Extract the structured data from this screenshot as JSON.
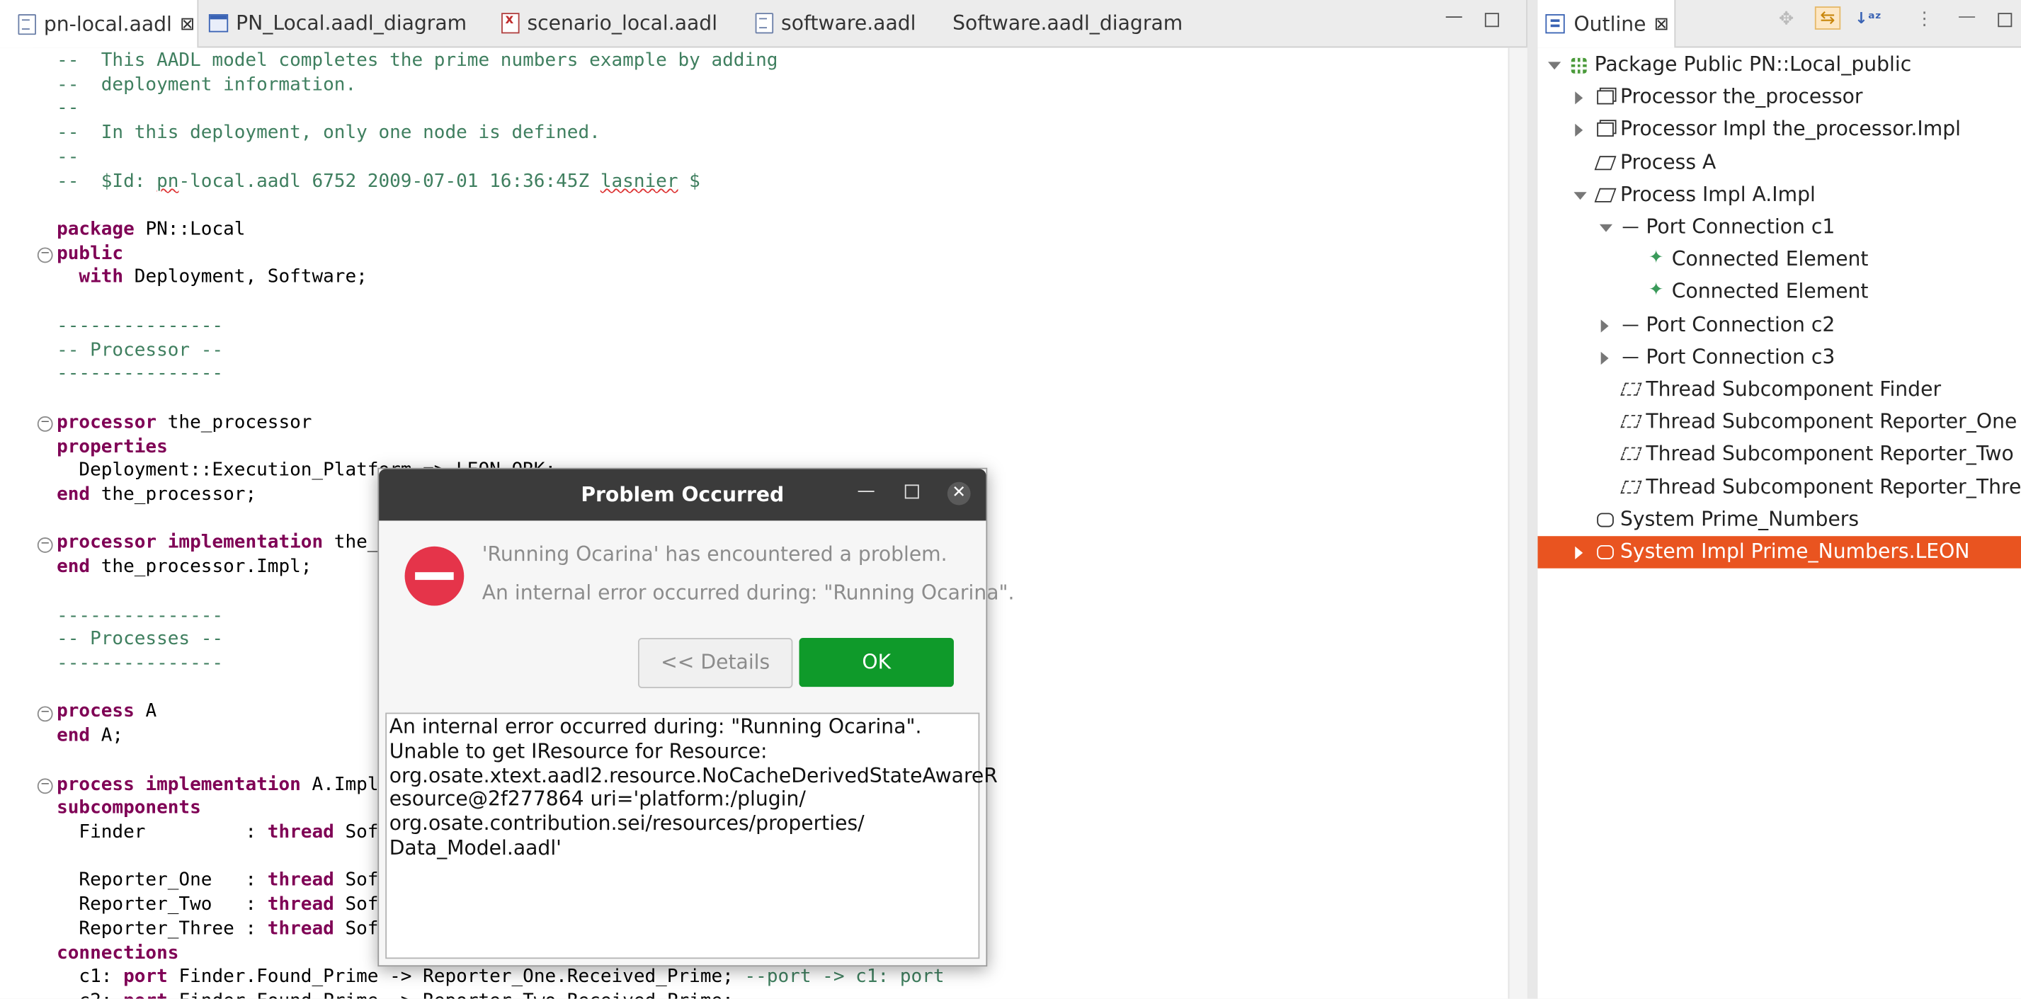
{
  "editor": {
    "tabs": [
      {
        "label": "pn-local.aadl",
        "active": true,
        "icon": "aadl-file-icon",
        "close": "⊠"
      },
      {
        "label": "PN_Local.aadl_diagram",
        "icon": "diagram-icon"
      },
      {
        "label": "scenario_local.aadl",
        "icon": "scenario-file-icon"
      },
      {
        "label": "software.aadl",
        "icon": "aadl-file-icon"
      },
      {
        "label": "Software.aadl_diagram",
        "icon": ""
      }
    ],
    "code": [
      [
        [
          "cm",
          "--  This AADL model completes the prime numbers example by adding"
        ]
      ],
      [
        [
          "cm",
          "--  deployment information."
        ]
      ],
      [
        [
          "cm",
          "--"
        ]
      ],
      [
        [
          "cm",
          "--  In this deployment, only one node is defined."
        ]
      ],
      [
        [
          "cm",
          "--"
        ]
      ],
      [
        [
          "cm",
          "--  $Id: "
        ],
        [
          "cmsq",
          "pn"
        ],
        [
          "cm",
          "-local.aadl 6752 2009-07-01 16:36:45Z "
        ],
        [
          "cmsq",
          "lasnier"
        ],
        [
          "cm",
          " $"
        ]
      ],
      [],
      [
        [
          "kw",
          "package"
        ],
        [
          "t",
          " PN::Local"
        ]
      ],
      [
        [
          "kw",
          "public"
        ]
      ],
      [
        [
          "t",
          "  "
        ],
        [
          "kw",
          "with"
        ],
        [
          "t",
          " Deployment, Software;"
        ]
      ],
      [],
      [
        [
          "cm",
          "---------------"
        ]
      ],
      [
        [
          "cm",
          "-- Processor --"
        ]
      ],
      [
        [
          "cm",
          "---------------"
        ]
      ],
      [],
      [
        [
          "kw",
          "processor"
        ],
        [
          "t",
          " the_processor"
        ]
      ],
      [
        [
          "kw",
          "properties"
        ]
      ],
      [
        [
          "t",
          "  Deployment::Execution_Platform => LEON_ORK;"
        ]
      ],
      [
        [
          "kw",
          "end"
        ],
        [
          "t",
          " the_processor;"
        ]
      ],
      [],
      [
        [
          "kw",
          "processor"
        ],
        [
          "t",
          " "
        ],
        [
          "kw",
          "implementation"
        ],
        [
          "t",
          " the_processor.Impl"
        ]
      ],
      [
        [
          "kw",
          "end"
        ],
        [
          "t",
          " the_processor.Impl;"
        ]
      ],
      [],
      [
        [
          "cm",
          "---------------"
        ]
      ],
      [
        [
          "cm",
          "-- Processes --"
        ]
      ],
      [
        [
          "cm",
          "---------------"
        ]
      ],
      [],
      [
        [
          "kw",
          "process"
        ],
        [
          "t",
          " A"
        ]
      ],
      [
        [
          "kw",
          "end"
        ],
        [
          "t",
          " A;"
        ]
      ],
      [],
      [
        [
          "kw",
          "process"
        ],
        [
          "t",
          " "
        ],
        [
          "kw",
          "implementation"
        ],
        [
          "t",
          " A.Impl"
        ]
      ],
      [
        [
          "kw",
          "subcomponents"
        ]
      ],
      [
        [
          "t",
          "  Finder         : "
        ],
        [
          "kw",
          "thread"
        ],
        [
          "t",
          " Software::Finder.Impl;"
        ]
      ],
      [],
      [
        [
          "t",
          "  Reporter_One   : "
        ],
        [
          "kw",
          "thread"
        ],
        [
          "t",
          " Software::Reporter.Impl;"
        ]
      ],
      [
        [
          "t",
          "  Reporter_Two   : "
        ],
        [
          "kw",
          "thread"
        ],
        [
          "t",
          " Software::Reporter.Impl;"
        ]
      ],
      [
        [
          "t",
          "  Reporter_Three : "
        ],
        [
          "kw",
          "thread"
        ],
        [
          "t",
          " Software::Reporter.Impl;"
        ]
      ],
      [
        [
          "kw",
          "connections"
        ]
      ],
      [
        [
          "t",
          "  c1: "
        ],
        [
          "kw",
          "port"
        ],
        [
          "t",
          " Finder.Found_Prime -> Reporter_One.Received_Prime; "
        ],
        [
          "cm",
          "--port -> c1: port"
        ]
      ],
      [
        [
          "t",
          "  c2: "
        ],
        [
          "kw",
          "port"
        ],
        [
          "t",
          " Finder.Found_Prime -> Reporter_Two.Received_Prime;"
        ]
      ]
    ],
    "fold_lines": [
      8,
      15,
      20,
      27,
      30
    ],
    "colors": {
      "comment": "#3f7f5f",
      "keyword": "#7f0055"
    }
  },
  "outline": {
    "tab_label": "Outline",
    "tab_close": "⊠",
    "toolbar": [
      "sync-icon",
      "link-editor-icon",
      "sort-az-icon",
      "view-menu-icon"
    ],
    "items": [
      {
        "label": "Package Public PN::Local_public",
        "icon": "package-icon",
        "depth": 0,
        "toggle": "open"
      },
      {
        "label": "Processor the_processor",
        "icon": "processor-icon",
        "depth": 1,
        "toggle": "closed"
      },
      {
        "label": "Processor Impl the_processor.Impl",
        "icon": "processor-icon",
        "depth": 1,
        "toggle": "closed"
      },
      {
        "label": "Process A",
        "icon": "process-icon",
        "depth": 1,
        "toggle": "none"
      },
      {
        "label": "Process Impl A.Impl",
        "icon": "process-icon",
        "depth": 1,
        "toggle": "open"
      },
      {
        "label": "Port Connection c1",
        "icon": "connection-icon",
        "depth": 2,
        "toggle": "open"
      },
      {
        "label": "Connected Element",
        "icon": "connected-element-icon",
        "depth": 3,
        "toggle": "none"
      },
      {
        "label": "Connected Element",
        "icon": "connected-element-icon",
        "depth": 3,
        "toggle": "none"
      },
      {
        "label": "Port Connection c2",
        "icon": "connection-icon",
        "depth": 2,
        "toggle": "closed"
      },
      {
        "label": "Port Connection c3",
        "icon": "connection-icon",
        "depth": 2,
        "toggle": "closed"
      },
      {
        "label": "Thread Subcomponent Finder",
        "icon": "thread-icon",
        "depth": 2,
        "toggle": "none"
      },
      {
        "label": "Thread Subcomponent Reporter_One",
        "icon": "thread-icon",
        "depth": 2,
        "toggle": "none"
      },
      {
        "label": "Thread Subcomponent Reporter_Two",
        "icon": "thread-icon",
        "depth": 2,
        "toggle": "none"
      },
      {
        "label": "Thread Subcomponent Reporter_Three",
        "icon": "thread-icon",
        "depth": 2,
        "toggle": "none"
      },
      {
        "label": "System Prime_Numbers",
        "icon": "system-icon",
        "depth": 1,
        "toggle": "none"
      },
      {
        "label": "System Impl Prime_Numbers.LEON",
        "icon": "system-icon",
        "depth": 1,
        "toggle": "closed",
        "selected": true
      }
    ],
    "selection_color": "#e95420"
  },
  "dialog": {
    "title": "Problem Occurred",
    "message": "'Running Ocarina' has encountered a problem.",
    "detail_summary": "An internal error occurred during: \"Running Ocarina\".",
    "details_button": "<< Details",
    "ok_button": "OK",
    "details_text": [
      "An internal error occurred during: \"Running Ocarina\".",
      "  Unable to get IResource for Resource:",
      "org.osate.xtext.aadl2.resource.NoCacheDerivedStateAwareR",
      "esource@2f277864 uri='platform:/plugin/",
      "org.osate.contribution.sei/resources/properties/",
      "Data_Model.aadl'"
    ],
    "colors": {
      "ok": "#0f9a2a",
      "error_icon": "#e5344a",
      "titlebar": "#3b3b3b"
    }
  }
}
